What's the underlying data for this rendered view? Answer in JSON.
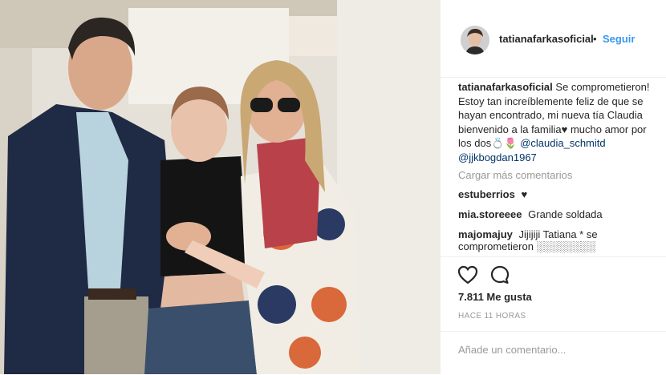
{
  "header": {
    "username": "tatianafarkasoficial",
    "separator": "•",
    "follow_label": "Seguir"
  },
  "caption": {
    "username": "tatianafarkasoficial",
    "text": "Se comprometieron! Estoy tan increíblemente feliz de que se hayan encontrado, mi nueva tía Claudia bienvenido a la familia♥ mucho amor por los dos💍🌷",
    "mention1": "@claudia_schmitd",
    "mention2": "@jjkbogdan1967"
  },
  "load_more": "Cargar más comentarios",
  "comments": [
    {
      "username": "estuberrios",
      "text": "♥"
    },
    {
      "username": "mia.storeeee",
      "text": "Grande soldada"
    },
    {
      "username": "majomajuy",
      "text": "Jijijiji Tatiana * se"
    }
  ],
  "comment_cut": "comprometieron ░░░░░░░░",
  "actions": {
    "like_icon": "heart-icon",
    "comment_icon": "comment-bubble-icon"
  },
  "likes": "7.811 Me gusta",
  "time": "HACE 11 HORAS",
  "add_comment_placeholder": "Añade un comentario..."
}
